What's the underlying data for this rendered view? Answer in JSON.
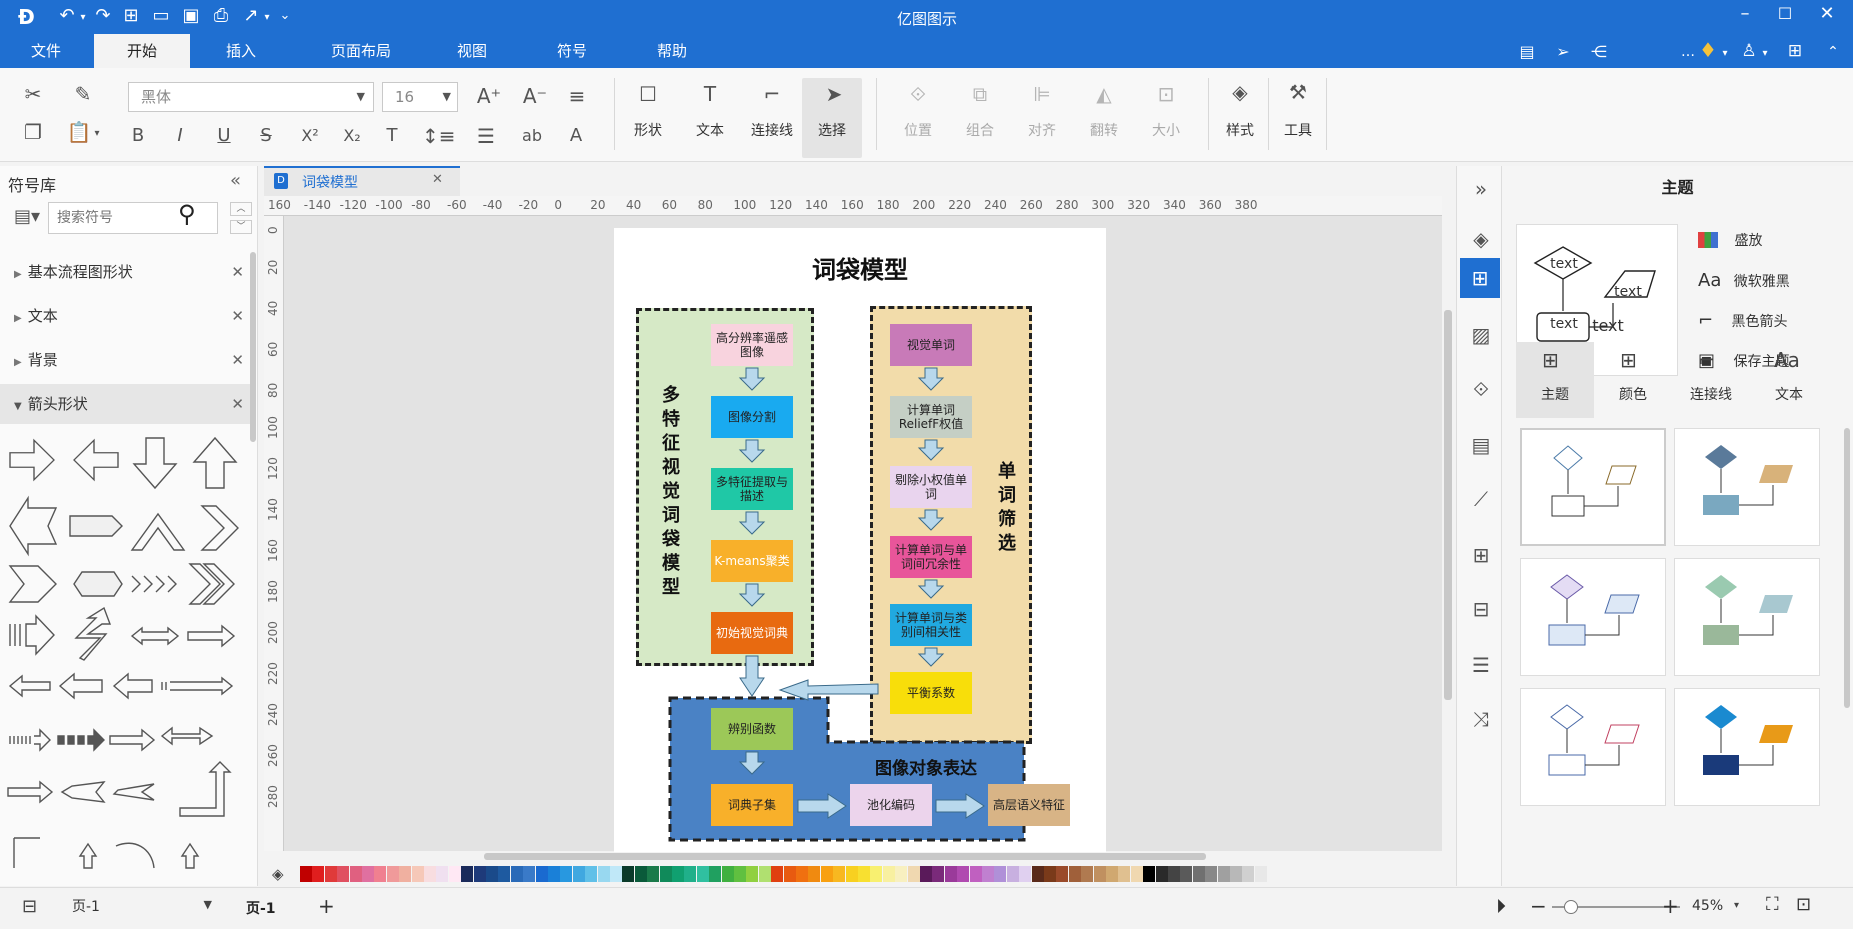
{
  "window": {
    "title": "亿图图示"
  },
  "menu": [
    "文件",
    "开始",
    "插入",
    "页面布局",
    "视图",
    "符号",
    "帮助"
  ],
  "ribbon": {
    "font_name": "黑体",
    "font_size": "16",
    "tools": [
      "形状",
      "文本",
      "连接线",
      "选择"
    ],
    "arrange": [
      "位置",
      "组合",
      "对齐",
      "翻转",
      "大小"
    ],
    "style": "样式",
    "tools_btn": "工具"
  },
  "library": {
    "title": "符号库",
    "search_placeholder": "搜索符号",
    "categories": [
      "基本流程图形状",
      "文本",
      "背景",
      "箭头形状"
    ]
  },
  "document": {
    "tab": "词袋模型"
  },
  "diagram": {
    "title": "词袋模型",
    "left_group_label": "多特征视觉词袋模型",
    "right_group_label": "单词筛选",
    "bottom_group_label": "图像对象表达",
    "left_nodes": [
      "高分辨率遥感图像",
      "图像分割",
      "多特征提取与描述",
      "K-means聚类",
      "初始视觉词典"
    ],
    "right_nodes": [
      "视觉单词",
      "计算单词ReliefF权值",
      "剔除小权值单词",
      "计算单词与单词间冗余性",
      "计算单词与类别间相关性",
      "平衡系数"
    ],
    "bottom_nodes": [
      "辨别函数",
      "词典子集",
      "池化编码",
      "高层语义特征"
    ]
  },
  "ruler_h": [
    "160",
    "-140",
    "-120",
    "-100",
    "-80",
    "-60",
    "-40",
    "-20",
    "0",
    "20",
    "40",
    "60",
    "80",
    "100",
    "120",
    "140",
    "160",
    "180",
    "200",
    "220",
    "240",
    "260",
    "280",
    "300",
    "320",
    "340",
    "360",
    "380"
  ],
  "ruler_v": [
    "0",
    "20",
    "40",
    "60",
    "80",
    "100",
    "120",
    "140",
    "160",
    "180",
    "200",
    "220",
    "240",
    "260",
    "280"
  ],
  "right_panel": {
    "title": "主题",
    "options": [
      "盛放",
      "微软雅黑",
      "黑色箭头",
      "保存主题"
    ],
    "tabs": [
      "主题",
      "颜色",
      "连接线",
      "文本"
    ],
    "preview_text": "text"
  },
  "status": {
    "page_select": "页-1",
    "page_tab": "页-1",
    "zoom": "45%"
  },
  "colors": {
    "accent": "#1f6fd1",
    "palette": [
      "#c00000",
      "#e01e1e",
      "#e03a3a",
      "#e05060",
      "#e06080",
      "#e070a0",
      "#f08090",
      "#f09a9a",
      "#f0b0a0",
      "#f6c8b8",
      "#f8dde0",
      "#f0e0f0",
      "#ffe8f4",
      "#1a2a5a",
      "#1e3a7a",
      "#1a4a8a",
      "#1e5aa0",
      "#2a6ab8",
      "#3a7ac8",
      "#1a6ad0",
      "#1a80d8",
      "#2898e0",
      "#40a8e0",
      "#60c0e8",
      "#98d8f0",
      "#c0e8f8",
      "#0a3a2a",
      "#0a5a3a",
      "#1a7a4a",
      "#108a5a",
      "#10a070",
      "#20b08a",
      "#30c0a0",
      "#20a060",
      "#40b040",
      "#60c040",
      "#90d040",
      "#b0e070",
      "#e04010",
      "#e85a10",
      "#f07010",
      "#f08a10",
      "#f8a010",
      "#f8b820",
      "#f8d020",
      "#f8e030",
      "#f8f070",
      "#f8f0a0",
      "#f8f0c0",
      "#f0d8b0",
      "#5a1a5a",
      "#7a2a7a",
      "#9a3a9a",
      "#b04ab0",
      "#c060c0",
      "#c080d0",
      "#b090d8",
      "#c8b0e0",
      "#e0d0f0",
      "#5a2a1a",
      "#7a3a1a",
      "#9a4a2a",
      "#a0603a",
      "#b07a50",
      "#c09060",
      "#d0a870",
      "#e0c090",
      "#f0d8b0",
      "#000000",
      "#2a2a2a",
      "#444444",
      "#5a5a5a",
      "#707070",
      "#888888",
      "#a0a0a0",
      "#b8b8b8",
      "#d0d0d0",
      "#e8e8e8"
    ]
  }
}
